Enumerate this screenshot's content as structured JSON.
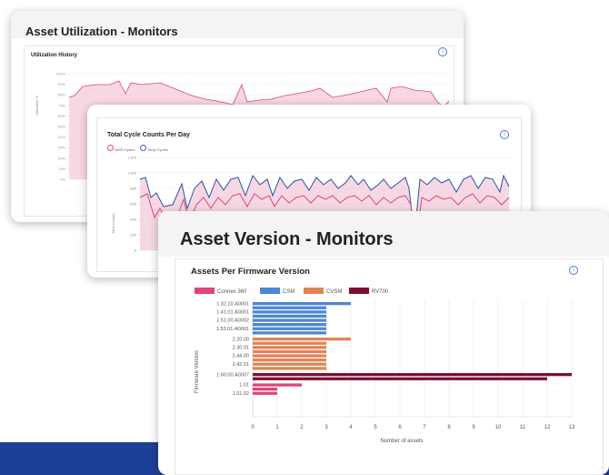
{
  "card1": {
    "title": "Asset Utilization - Monitors",
    "chart_title": "Utilization History",
    "y_ticks": [
      "100%",
      "90%",
      "80%",
      "70%",
      "60%",
      "50%",
      "40%",
      "30%",
      "20%",
      "10%",
      "0%"
    ],
    "ylabel": "Utilization %",
    "info_icon": "info-icon"
  },
  "card2": {
    "chart_title": "Total Cycle Counts Per Day",
    "legend": [
      "NIBP Cycles",
      "Temp Cycles"
    ],
    "y_ticks": [
      "1,200",
      "1,000",
      "800",
      "600",
      "400",
      "200",
      "0"
    ],
    "ylabel": "Total Counts",
    "info_icon": "info-icon"
  },
  "card3": {
    "title": "Asset Version - Monitors",
    "info_icon": "info-icon"
  },
  "colors": {
    "connex": "#e0457b",
    "csm": "#4f86d6",
    "cvsm": "#e08455",
    "rv700": "#7d0f35",
    "band": "#1e3f97"
  },
  "chart_data": {
    "type": "bar",
    "orientation": "horizontal",
    "title": "Assets Per Firmware Version",
    "xlabel": "Number of assets",
    "ylabel": "Firmware Version",
    "xlim": [
      0,
      13
    ],
    "x_ticks": [
      "0",
      "1",
      "2",
      "3",
      "4",
      "5",
      "6",
      "7",
      "8",
      "9",
      "10",
      "11",
      "12",
      "13"
    ],
    "legend": [
      "Connex 360",
      "CSM",
      "CVSM",
      "RV700"
    ],
    "groups": [
      {
        "series": "CSM",
        "color": "#4f86d6",
        "bars": [
          {
            "label": "1.32.10.A0001",
            "value": 4
          },
          {
            "label": "",
            "value": 3
          },
          {
            "label": "1.41.01.A0001",
            "value": 3
          },
          {
            "label": "",
            "value": 3
          },
          {
            "label": "1.51.00.A0002",
            "value": 3
          },
          {
            "label": "",
            "value": 3
          },
          {
            "label": "1.52.01-A0001",
            "value": 3
          },
          {
            "label": "",
            "value": 3
          }
        ]
      },
      {
        "series": "CVSM",
        "color": "#e08455",
        "bars": [
          {
            "label": "2.20.00",
            "value": 4
          },
          {
            "label": "",
            "value": 3
          },
          {
            "label": "2.30.01",
            "value": 3
          },
          {
            "label": "",
            "value": 3
          },
          {
            "label": "2.44.00",
            "value": 3
          },
          {
            "label": "",
            "value": 3
          },
          {
            "label": "2.42.01",
            "value": 3
          },
          {
            "label": "",
            "value": 3
          }
        ]
      },
      {
        "series": "RV700",
        "color": "#7d0f35",
        "bars": [
          {
            "label": "1.60.00.A0007",
            "value": 13
          },
          {
            "label": "",
            "value": 12
          }
        ]
      },
      {
        "series": "Connex 360",
        "color": "#e0457b",
        "bars": [
          {
            "label": "1.01",
            "value": 2
          },
          {
            "label": "",
            "value": 1
          },
          {
            "label": "1.01.02",
            "value": 1
          }
        ]
      }
    ]
  }
}
